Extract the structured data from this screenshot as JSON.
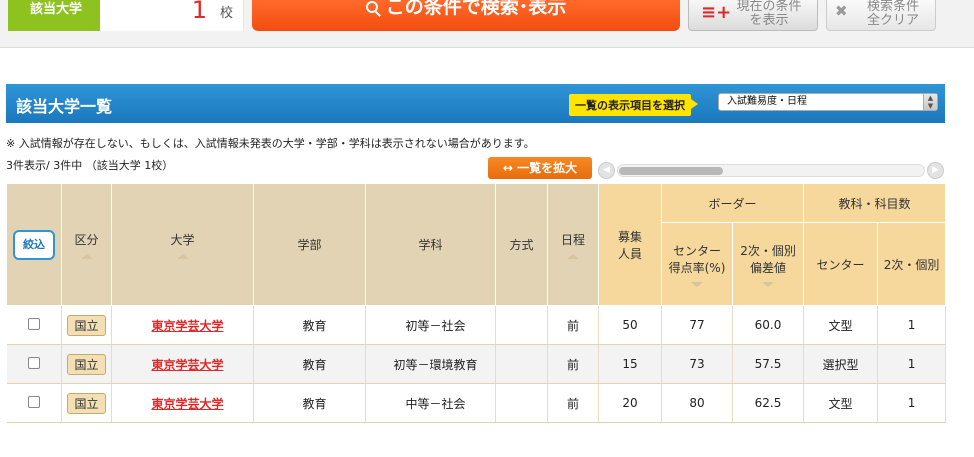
{
  "search": {
    "label": "該当大学",
    "count": "1",
    "count_unit": "校",
    "search_button": "この条件で検索･表示",
    "show_button": "現在の条件\nを表示",
    "show_line1": "現在の条件",
    "show_line2": "を表示",
    "clear_line1": "検索条件",
    "clear_line2": "全クリア"
  },
  "list": {
    "title": "該当大学一覧",
    "display_label": "一覧の表示項目を選択",
    "display_value": "入試難易度・日程"
  },
  "note": "※ 入試情報が存在しない、もしくは、入試情報未発表の大学・学部・学科は表示されない場合があります。",
  "count_info": "3件表示/ 3件中 （該当大学 1校）",
  "expand_button": "一覧を拡大",
  "table": {
    "headers": {
      "filter": "絞込",
      "kubun": "区分",
      "daigaku": "大学",
      "gakubu": "学部",
      "gakka": "学科",
      "houshiki": "方式",
      "nittei": "日程",
      "boshu_1": "募集",
      "boshu_2": "人員",
      "border": "ボーダー",
      "center_rate_1": "センター",
      "center_rate_2": "得点率(%)",
      "second_dev_1": "2次・個別",
      "second_dev_2": "偏差値",
      "subjects": "教科・科目数",
      "subj_center": "センター",
      "subj_second": "2次・個別"
    },
    "rows": [
      {
        "kubun": "国立",
        "univ": "東京学芸大学",
        "faculty": "教育",
        "dept": "初等－社会",
        "method": "",
        "schedule": "前",
        "capacity": "50",
        "center_rate": "77",
        "deviation": "60.0",
        "center_subj": "文型",
        "second_subj": "1"
      },
      {
        "kubun": "国立",
        "univ": "東京学芸大学",
        "faculty": "教育",
        "dept": "初等－環境教育",
        "method": "",
        "schedule": "前",
        "capacity": "15",
        "center_rate": "73",
        "deviation": "57.5",
        "center_subj": "選択型",
        "second_subj": "1"
      },
      {
        "kubun": "国立",
        "univ": "東京学芸大学",
        "faculty": "教育",
        "dept": "中等－社会",
        "method": "",
        "schedule": "前",
        "capacity": "20",
        "center_rate": "80",
        "deviation": "62.5",
        "center_subj": "文型",
        "second_subj": "1"
      }
    ]
  },
  "colors": {
    "univ_label_bg": "#8dc21f",
    "search_button_bg": "#f24d10",
    "header_bar_bg": "#1b78bd",
    "link_red": "#e02828",
    "table_header_bg": "#e8cf9f"
  }
}
